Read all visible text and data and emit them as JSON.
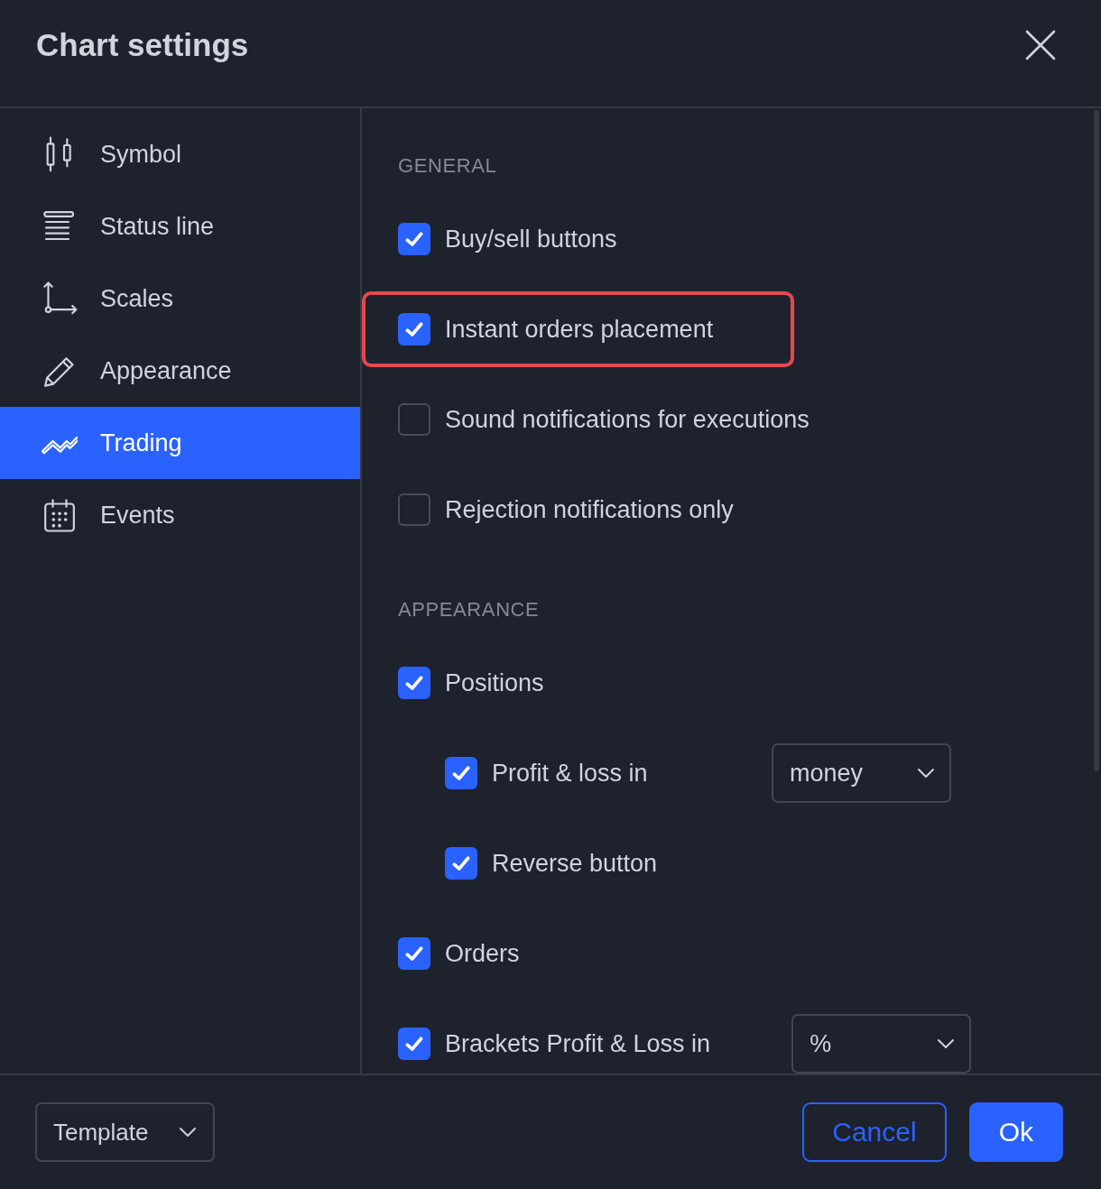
{
  "window": {
    "title": "Chart settings"
  },
  "sidebar": {
    "items": [
      {
        "label": "Symbol",
        "selected": false
      },
      {
        "label": "Status line",
        "selected": false
      },
      {
        "label": "Scales",
        "selected": false
      },
      {
        "label": "Appearance",
        "selected": false
      },
      {
        "label": "Trading",
        "selected": true
      },
      {
        "label": "Events",
        "selected": false
      }
    ]
  },
  "sections": [
    {
      "title": "GENERAL",
      "items": [
        {
          "label": "Buy/sell buttons",
          "checked": true,
          "highlighted": false
        },
        {
          "label": "Instant orders placement",
          "checked": true,
          "highlighted": true
        },
        {
          "label": "Sound notifications for executions",
          "checked": false,
          "highlighted": false
        },
        {
          "label": "Rejection notifications only",
          "checked": false,
          "highlighted": false
        }
      ]
    },
    {
      "title": "APPEARANCE",
      "items": [
        {
          "label": "Positions",
          "checked": true,
          "children": [
            {
              "label": "Profit & loss in",
              "checked": true,
              "dropdown": {
                "value": "money"
              }
            },
            {
              "label": "Reverse button",
              "checked": true
            }
          ]
        },
        {
          "label": "Orders",
          "checked": true
        },
        {
          "label": "Brackets Profit & Loss in",
          "checked": true,
          "dropdown": {
            "value": "%"
          }
        }
      ]
    }
  ],
  "footer": {
    "template": {
      "label": "Template"
    },
    "buttons": [
      {
        "label": "Cancel",
        "kind": "secondary"
      },
      {
        "label": "Ok",
        "kind": "primary"
      }
    ]
  }
}
